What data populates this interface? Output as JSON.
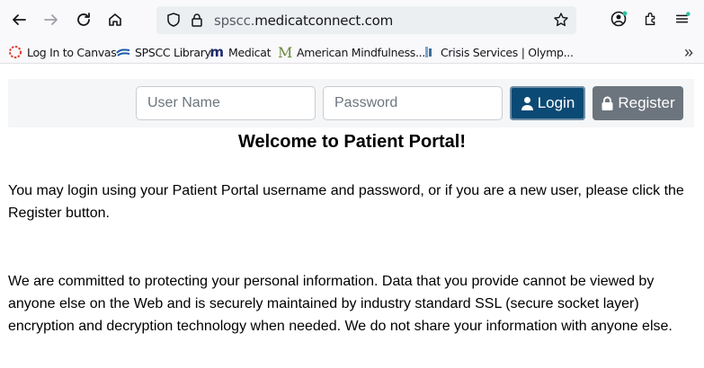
{
  "browser": {
    "url_domain_prefix": "spscc.",
    "url_domain_main": "medicatconnect.com",
    "bookmarks": [
      {
        "label": "Log In to Canvas",
        "icon": "canvas-icon"
      },
      {
        "label": "SPSCC Library",
        "icon": "library-icon"
      },
      {
        "label": "Medicat",
        "icon": "medicat-icon"
      },
      {
        "label": "American Mindfulness...",
        "icon": "mindfulness-icon"
      },
      {
        "label": "Crisis Services | Olymp...",
        "icon": "crisis-icon"
      }
    ]
  },
  "login": {
    "username_placeholder": "User Name",
    "password_placeholder": "Password",
    "login_label": "Login",
    "register_label": "Register"
  },
  "content": {
    "title": "Welcome to Patient Portal!",
    "para1": "You may login using your Patient Portal username and password, or if you are a new user, please click the Register button.",
    "para2": "We are committed to protecting your personal information. Data that you provide cannot be viewed by anyone else on the Web and is securely maintained by industry standard SSL (secure socket layer) encryption and decryption technology when needed. We do not share your information with anyone else."
  },
  "colors": {
    "login_button": "#0b4a75",
    "register_button": "#6c757d"
  }
}
